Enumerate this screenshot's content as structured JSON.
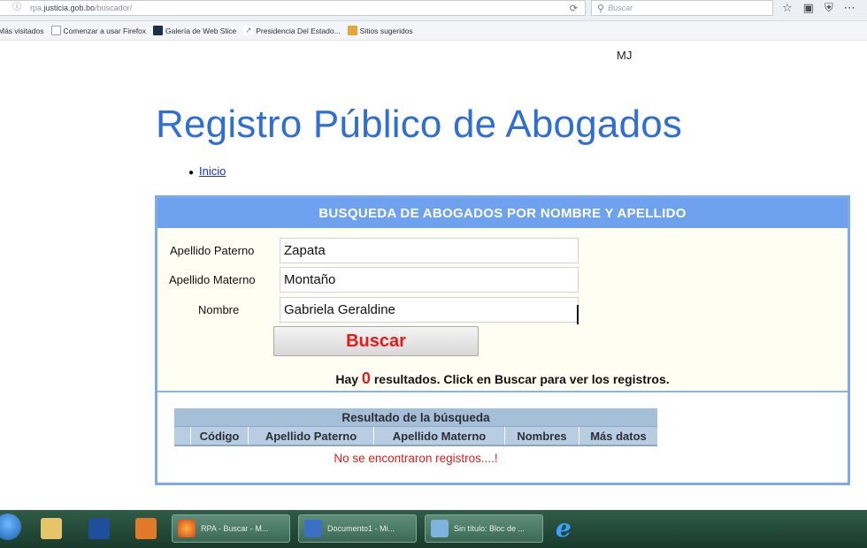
{
  "browser": {
    "url_prefix": "rpa.",
    "url_domain": "justicia.gob.bo",
    "url_path": "/buscador/",
    "search_placeholder": "Buscar",
    "icons": [
      "star-icon",
      "clipboard-icon",
      "shield-icon",
      "menu-dots-icon"
    ]
  },
  "bookmarks": [
    {
      "label": "Más visitados",
      "icon": "none"
    },
    {
      "label": "Comenzar a usar Firefox",
      "icon": "page-icon"
    },
    {
      "label": "Galería de Web Slice",
      "icon": "web-slice-icon"
    },
    {
      "label": "Presidencia Del Estado...",
      "icon": "page-icon"
    },
    {
      "label": "Sitios sugeridos",
      "icon": "folder-icon"
    }
  ],
  "header": {
    "user": "MJ",
    "title": "Registro Público de Abogados",
    "nav": [
      "Inicio"
    ]
  },
  "search_panel": {
    "title": "BUSQUEDA DE ABOGADOS POR NOMBRE Y APELLIDO",
    "fields": [
      {
        "label": "Apellido Paterno",
        "value": "Zapata"
      },
      {
        "label": "Apellido Materno",
        "value": "Montaño"
      },
      {
        "label": "Nombre",
        "value": "Gabriela Geraldine"
      }
    ],
    "button_label": "Buscar",
    "result_prefix": "Hay",
    "result_count": "0",
    "result_suffix": "resultados. Click en Buscar para ver los registros."
  },
  "results": {
    "title": "Resultado de la búsqueda",
    "columns": [
      "Código",
      "Apellido Paterno",
      "Apellido Materno",
      "Nombres",
      "Más datos"
    ],
    "empty_message": "No se encontraron registros....!"
  },
  "taskbar": {
    "tasks": [
      {
        "label": "RPA - Buscar - M..."
      },
      {
        "label": "Documento1 - Mi..."
      },
      {
        "label": "Sin título: Bloc de ..."
      }
    ]
  }
}
